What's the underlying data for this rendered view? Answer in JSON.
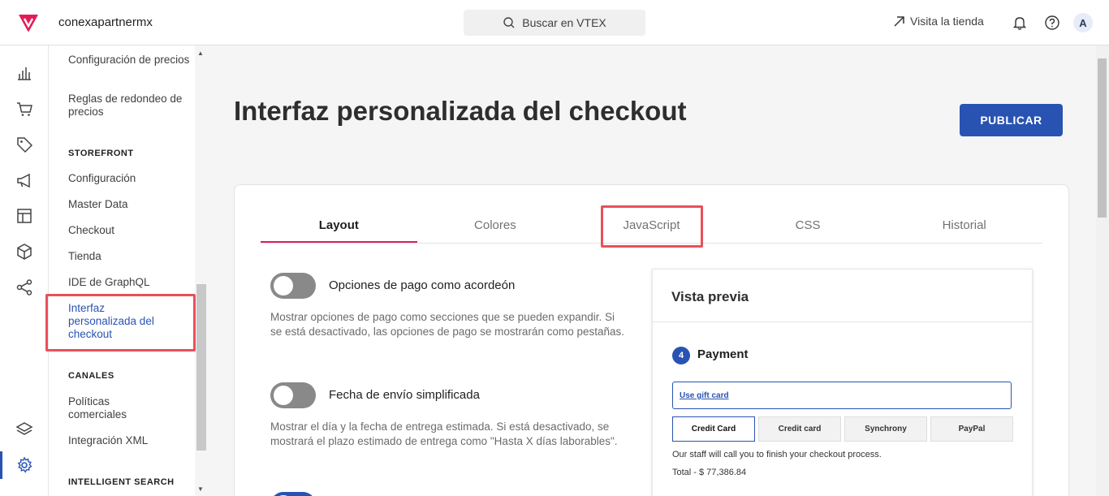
{
  "topbar": {
    "account": "conexapartnermx",
    "search_label": "Buscar en VTEX",
    "visit_store": "Visita la tienda",
    "avatar_letter": "A",
    "brand_color": "#e31c58"
  },
  "sidebar": {
    "items_top": [
      {
        "label": "Configuración de precios"
      },
      {
        "label": "Reglas de redondeo de precios"
      }
    ],
    "section_storefront": "STOREFRONT",
    "storefront_items": [
      {
        "label": "Configuración"
      },
      {
        "label": "Master Data"
      },
      {
        "label": "Checkout"
      },
      {
        "label": "Tienda"
      },
      {
        "label": "IDE de GraphQL"
      },
      {
        "label": "Interfaz personalizada del checkout"
      }
    ],
    "section_canales": "CANALES",
    "canales_items": [
      {
        "label": "Políticas comerciales"
      },
      {
        "label": "Integración XML"
      }
    ],
    "section_search": "INTELLIGENT SEARCH"
  },
  "main": {
    "title": "Interfaz personalizada del checkout",
    "publish_label": "PUBLICAR",
    "tabs": [
      {
        "label": "Layout"
      },
      {
        "label": "Colores"
      },
      {
        "label": "JavaScript"
      },
      {
        "label": "CSS"
      },
      {
        "label": "Historial"
      }
    ],
    "options": [
      {
        "label": "Opciones de pago como acordeón",
        "description": "Mostrar opciones de pago como secciones que se pueden expandir. Si se está desactivado, las opciones de pago se mostrarán como pestañas."
      },
      {
        "label": "Fecha de envío simplificada",
        "description": "Mostrar el día y la fecha de entrega estimada. Si está desactivado, se mostrará el plazo estimado de entrega como \"Hasta X días laborables\"."
      }
    ]
  },
  "preview": {
    "title": "Vista previa",
    "step_number": "4",
    "payment_title": "Payment",
    "gift_card": "Use gift card",
    "pay_tabs": [
      {
        "label": "Credit Card"
      },
      {
        "label": "Credit card"
      },
      {
        "label": "Synchrony"
      },
      {
        "label": "PayPal"
      }
    ],
    "staff_note": "Our staff will call you to finish your checkout process.",
    "total": "Total - $ 77,386.84"
  }
}
